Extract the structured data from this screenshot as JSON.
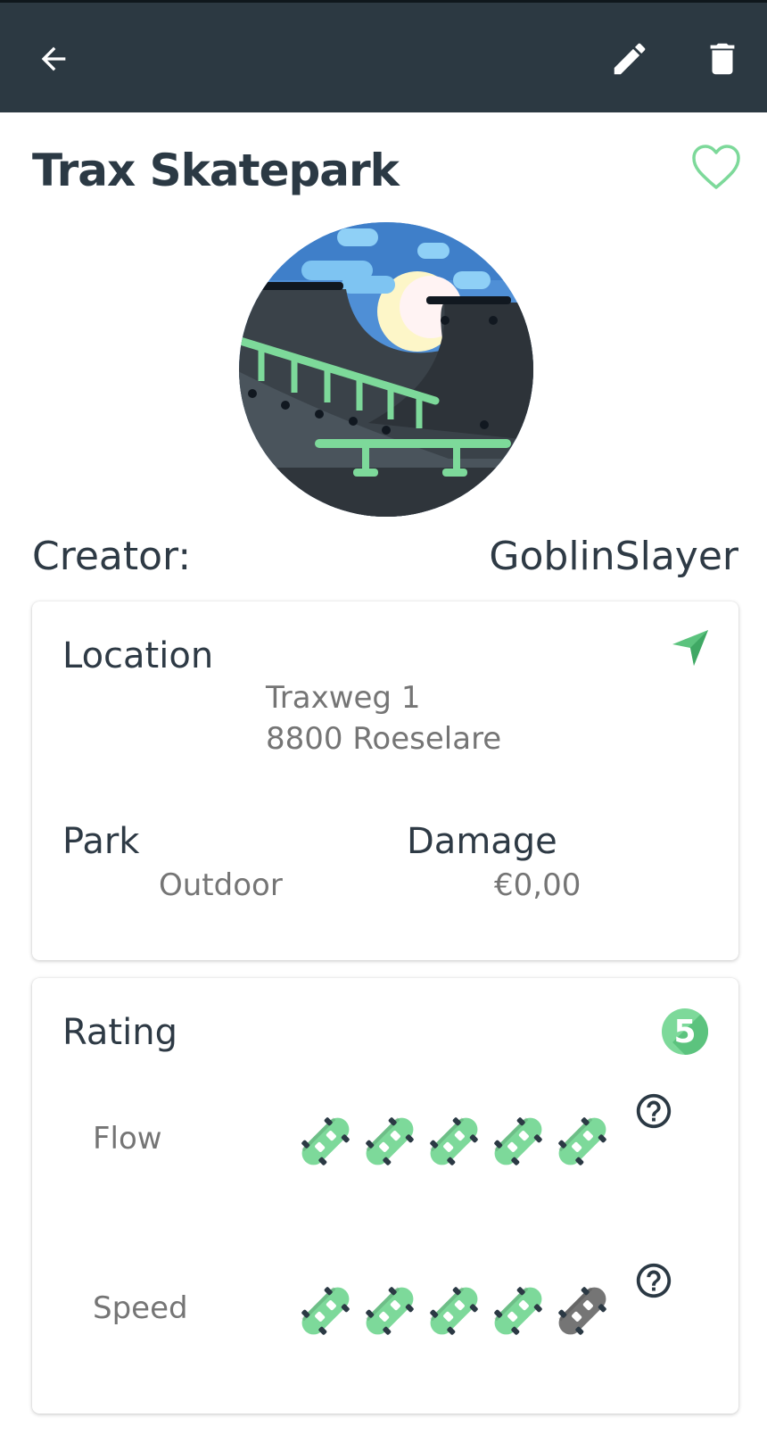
{
  "app_bar": {
    "back_icon": "arrow-left-icon",
    "edit_icon": "pencil-icon",
    "delete_icon": "trash-icon"
  },
  "park": {
    "name": "Trax Skatepark",
    "favorite_icon": "heart-outline-icon",
    "creator_label": "Creator:",
    "creator_name": "GoblinSlayer"
  },
  "location_card": {
    "title": "Location",
    "navigate_icon": "navigation-arrow-icon",
    "address_line1": "Traxweg 1",
    "address_line2": "8800 Roeselare",
    "park_label": "Park",
    "park_value": "Outdoor",
    "damage_label": "Damage",
    "damage_value": "€0,00"
  },
  "rating_card": {
    "title": "Rating",
    "total_badge": "5",
    "criteria": [
      {
        "label": "Flow",
        "rating": 5,
        "max": 5,
        "help_icon": "help-circle-icon"
      },
      {
        "label": "Speed",
        "rating": 4,
        "max": 5,
        "help_icon": "help-circle-icon"
      }
    ]
  },
  "colors": {
    "app_bar": "#2c3942",
    "accent_green": "#7dd99a",
    "text_dark": "#2e3a45",
    "text_muted": "#757575",
    "board_inactive": "#757575"
  }
}
